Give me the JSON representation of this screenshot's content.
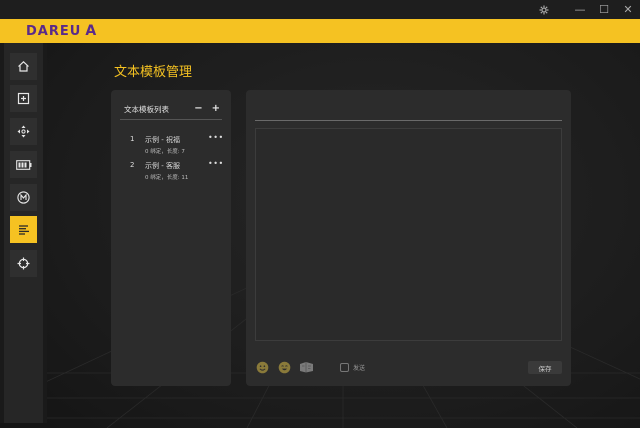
{
  "window": {
    "settings_icon": "gear-icon",
    "minimize_glyph": "—",
    "maximize_glyph": "☐",
    "close_glyph": "✕"
  },
  "brand": {
    "logo_text": "DAREU",
    "logo_mark": "A",
    "accent_color": "#f5c222",
    "logo_color": "#5a2a8a"
  },
  "sidebar": {
    "items": [
      {
        "icon": "home-icon",
        "active": false
      },
      {
        "icon": "add-square-icon",
        "active": false
      },
      {
        "icon": "move-arrows-icon",
        "active": false
      },
      {
        "icon": "battery-icon",
        "active": false
      },
      {
        "icon": "macro-m-icon",
        "active": false
      },
      {
        "icon": "text-template-icon",
        "active": true
      },
      {
        "icon": "crosshair-icon",
        "active": false
      }
    ]
  },
  "page": {
    "title": "文本模板管理"
  },
  "template_list": {
    "title": "文本模板列表",
    "remove_label": "−",
    "add_label": "+",
    "items": [
      {
        "index": "1",
        "name": "示例 - 祝福",
        "meta": "0 绑定，长度: 7",
        "more": "•••"
      },
      {
        "index": "2",
        "name": "示例 - 客服",
        "meta": "0 绑定，长度: 11",
        "more": "•••"
      }
    ]
  },
  "editor": {
    "name_value": "",
    "content_value": "",
    "emoji_icons": [
      "smile-emoji-icon",
      "grin-emoji-icon",
      "sticker-icon"
    ],
    "send_label": "发送",
    "send_checked": false,
    "save_label": "保存"
  }
}
